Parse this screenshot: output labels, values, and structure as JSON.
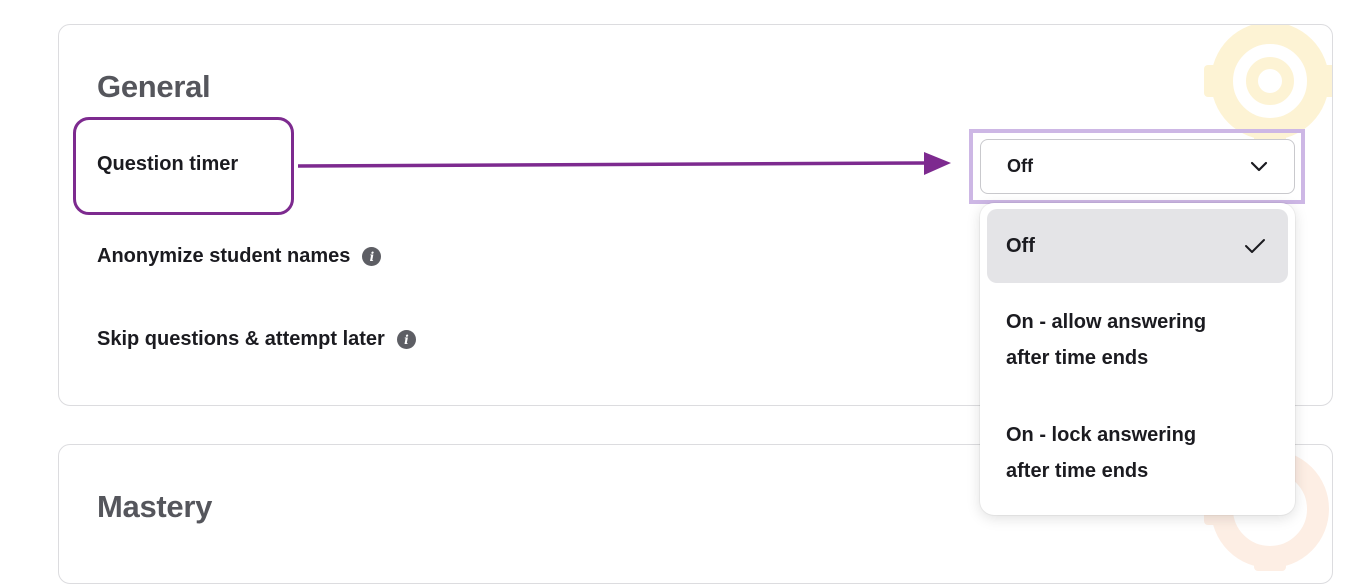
{
  "general": {
    "title": "General",
    "settings": [
      {
        "label": "Question timer",
        "has_info": false
      },
      {
        "label": "Anonymize student names",
        "has_info": true
      },
      {
        "label": "Skip questions & attempt later",
        "has_info": true
      }
    ]
  },
  "question_timer_select": {
    "value": "Off",
    "icon": "chevron-down-icon",
    "options": [
      {
        "label": "Off",
        "selected": true,
        "icon": "check-icon"
      },
      {
        "label_line1": "On - allow answering",
        "label_line2": "after time ends",
        "selected": false
      },
      {
        "label_line1": "On - lock answering",
        "label_line2": "after time ends",
        "selected": false
      }
    ]
  },
  "mastery": {
    "title": "Mastery"
  },
  "colors": {
    "annotation_purple": "#7d2a8f",
    "select_highlight": "#cdb7e5",
    "deco_yellow": "#fdf3d4",
    "deco_peach": "#fdeee4"
  }
}
